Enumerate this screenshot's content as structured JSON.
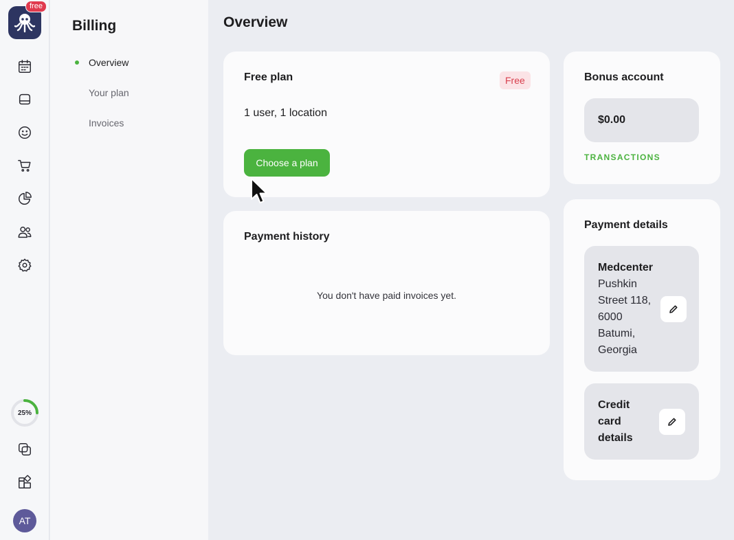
{
  "rail": {
    "plan_badge": "free",
    "progress_label": "25%",
    "progress_value": 0.25,
    "avatar_initials": "AT",
    "icons": [
      "calendar-icon",
      "chat-icon",
      "smiley-icon",
      "cart-icon",
      "pie-chart-icon",
      "users-icon",
      "gear-icon",
      "copy-icon",
      "apps-icon"
    ]
  },
  "subnav": {
    "title": "Billing",
    "items": [
      {
        "label": "Overview",
        "active": true
      },
      {
        "label": "Your plan",
        "active": false
      },
      {
        "label": "Invoices",
        "active": false
      }
    ]
  },
  "main": {
    "title": "Overview",
    "plan_card": {
      "title": "Free plan",
      "badge": "Free",
      "description": "1 user, 1 location",
      "button": "Choose a plan"
    },
    "history_card": {
      "title": "Payment history",
      "empty_text": "You don't have paid invoices yet."
    },
    "bonus_card": {
      "title": "Bonus account",
      "balance": "$0.00",
      "transactions_link": "TRANSACTIONS"
    },
    "payment_card": {
      "title": "Payment details",
      "company": "Medcenter",
      "address": "Pushkin Street 118, 6000 Batumi, Georgia",
      "credit_card_label": "Credit card details"
    }
  },
  "colors": {
    "accent_green": "#4bb33f",
    "badge_red": "#d8404e",
    "logo_bg": "#2d3561"
  }
}
